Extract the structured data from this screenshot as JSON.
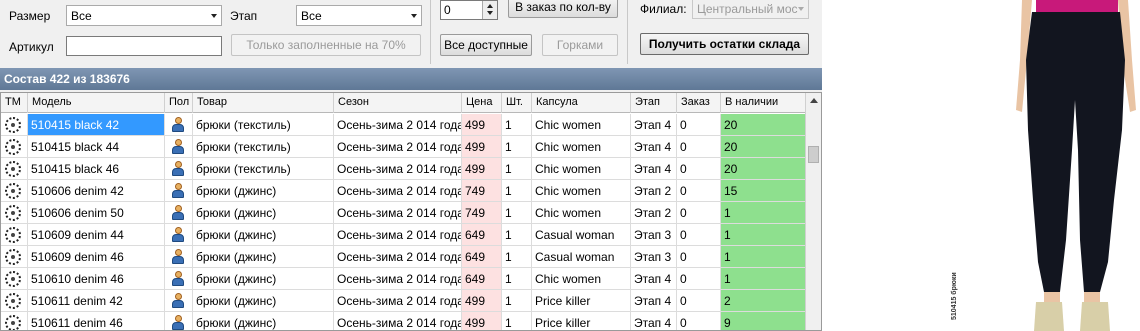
{
  "filters": {
    "size_label": "Размер",
    "size_value": "Все",
    "stage_label": "Этап",
    "stage_value": "Все",
    "article_label": "Артикул",
    "article_value": "",
    "filled_button": "Только заполненные на 70%"
  },
  "order": {
    "qty_value": "0",
    "order_by_qty_button": "В заказ по кол-ву",
    "all_available_button": "Все доступные",
    "hills_button": "Горками"
  },
  "branch": {
    "label": "Филиал:",
    "value": "Центральный мос",
    "get_stock_button": "Получить остатки склада"
  },
  "section_title": "Состав 422 из 183676",
  "columns": [
    "ТМ",
    "Модель",
    "Пол",
    "Товар",
    "Сезон",
    "Цена",
    "Шт.",
    "Капсула",
    "Этап",
    "Заказ",
    "В наличии"
  ],
  "rows": [
    {
      "model": "510415 black  42",
      "product": "брюки (текстиль)",
      "season": "Осень-зима 2 014 года",
      "price": "499",
      "qty": "1",
      "capsule": "Chic women",
      "stage": "Этап 4",
      "order": "0",
      "stock": "20",
      "selected": true
    },
    {
      "model": "510415 black  44",
      "product": "брюки (текстиль)",
      "season": "Осень-зима 2 014 года",
      "price": "499",
      "qty": "1",
      "capsule": "Chic women",
      "stage": "Этап 4",
      "order": "0",
      "stock": "20"
    },
    {
      "model": "510415 black  46",
      "product": "брюки (текстиль)",
      "season": "Осень-зима 2 014 года",
      "price": "499",
      "qty": "1",
      "capsule": "Chic women",
      "stage": "Этап 4",
      "order": "0",
      "stock": "20"
    },
    {
      "model": "510606 denim  42",
      "product": "брюки (джинс)",
      "season": "Осень-зима 2 014 года",
      "price": "749",
      "qty": "1",
      "capsule": "Chic women",
      "stage": "Этап 2",
      "order": "0",
      "stock": "15"
    },
    {
      "model": "510606 denim  50",
      "product": "брюки (джинс)",
      "season": "Осень-зима 2 014 года",
      "price": "749",
      "qty": "1",
      "capsule": "Chic women",
      "stage": "Этап 2",
      "order": "0",
      "stock": "1"
    },
    {
      "model": "510609 denim  44",
      "product": "брюки (джинс)",
      "season": "Осень-зима 2 014 года",
      "price": "649",
      "qty": "1",
      "capsule": "Casual woman",
      "stage": "Этап 3",
      "order": "0",
      "stock": "1"
    },
    {
      "model": "510609 denim  46",
      "product": "брюки (джинс)",
      "season": "Осень-зима 2 014 года",
      "price": "649",
      "qty": "1",
      "capsule": "Casual woman",
      "stage": "Этап 3",
      "order": "0",
      "stock": "1"
    },
    {
      "model": "510610 denim  46",
      "product": "брюки (джинс)",
      "season": "Осень-зима 2 014 года",
      "price": "649",
      "qty": "1",
      "capsule": "Chic women",
      "stage": "Этап 4",
      "order": "0",
      "stock": "1"
    },
    {
      "model": "510611 denim  42",
      "product": "брюки (джинс)",
      "season": "Осень-зима 2 014 года",
      "price": "499",
      "qty": "1",
      "capsule": "Price killer",
      "stage": "Этап 4",
      "order": "0",
      "stock": "2"
    },
    {
      "model": "510611 denim  46",
      "product": "брюки (джинс)",
      "season": "Осень-зима 2 014 года",
      "price": "499",
      "qty": "1",
      "capsule": "Price killer",
      "stage": "Этап 4",
      "order": "0",
      "stock": "9"
    }
  ],
  "icons": {
    "tm": "brand-logo-icon",
    "gender": "person-icon"
  },
  "colors": {
    "price_bg": "#fde1e1",
    "stock_bg": "#8ee08e",
    "selected_bg": "#3399ff",
    "section_bar": "#6a82a2"
  },
  "preview": {
    "caption": "510415 брюки"
  }
}
